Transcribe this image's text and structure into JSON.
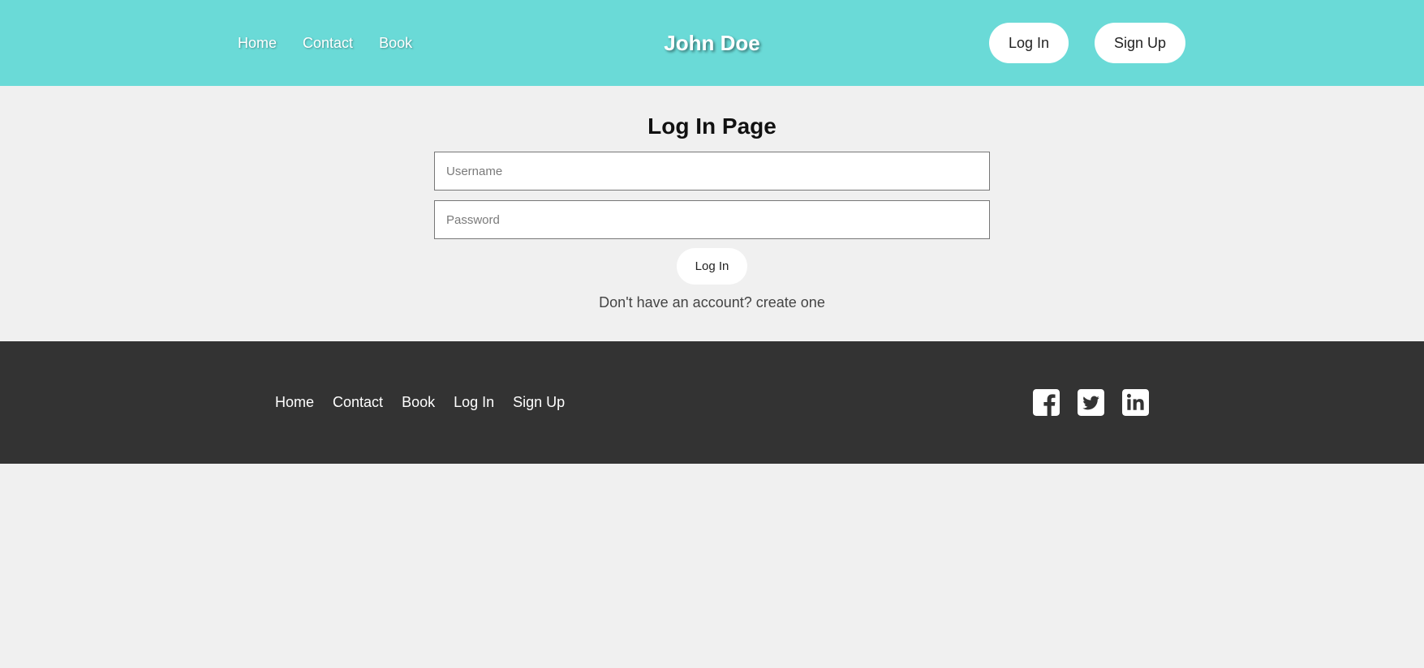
{
  "header": {
    "nav": [
      {
        "label": "Home"
      },
      {
        "label": "Contact"
      },
      {
        "label": "Book"
      }
    ],
    "brand": "John Doe",
    "login_label": "Log In",
    "signup_label": "Sign Up"
  },
  "main": {
    "title": "Log In Page",
    "username_placeholder": "Username",
    "password_placeholder": "Password",
    "submit_label": "Log In",
    "prompt_text": "Don't have an account?",
    "prompt_link": "create one"
  },
  "footer": {
    "nav": [
      {
        "label": "Home"
      },
      {
        "label": "Contact"
      },
      {
        "label": "Book"
      },
      {
        "label": "Log In"
      },
      {
        "label": "Sign Up"
      }
    ],
    "social": [
      {
        "icon": "facebook-icon"
      },
      {
        "icon": "twitter-icon"
      },
      {
        "icon": "linkedin-icon"
      }
    ]
  },
  "colors": {
    "header_bg": "#6adad7",
    "page_bg": "#f0f0f0",
    "footer_bg": "#333333",
    "button_bg": "#ffffff"
  }
}
